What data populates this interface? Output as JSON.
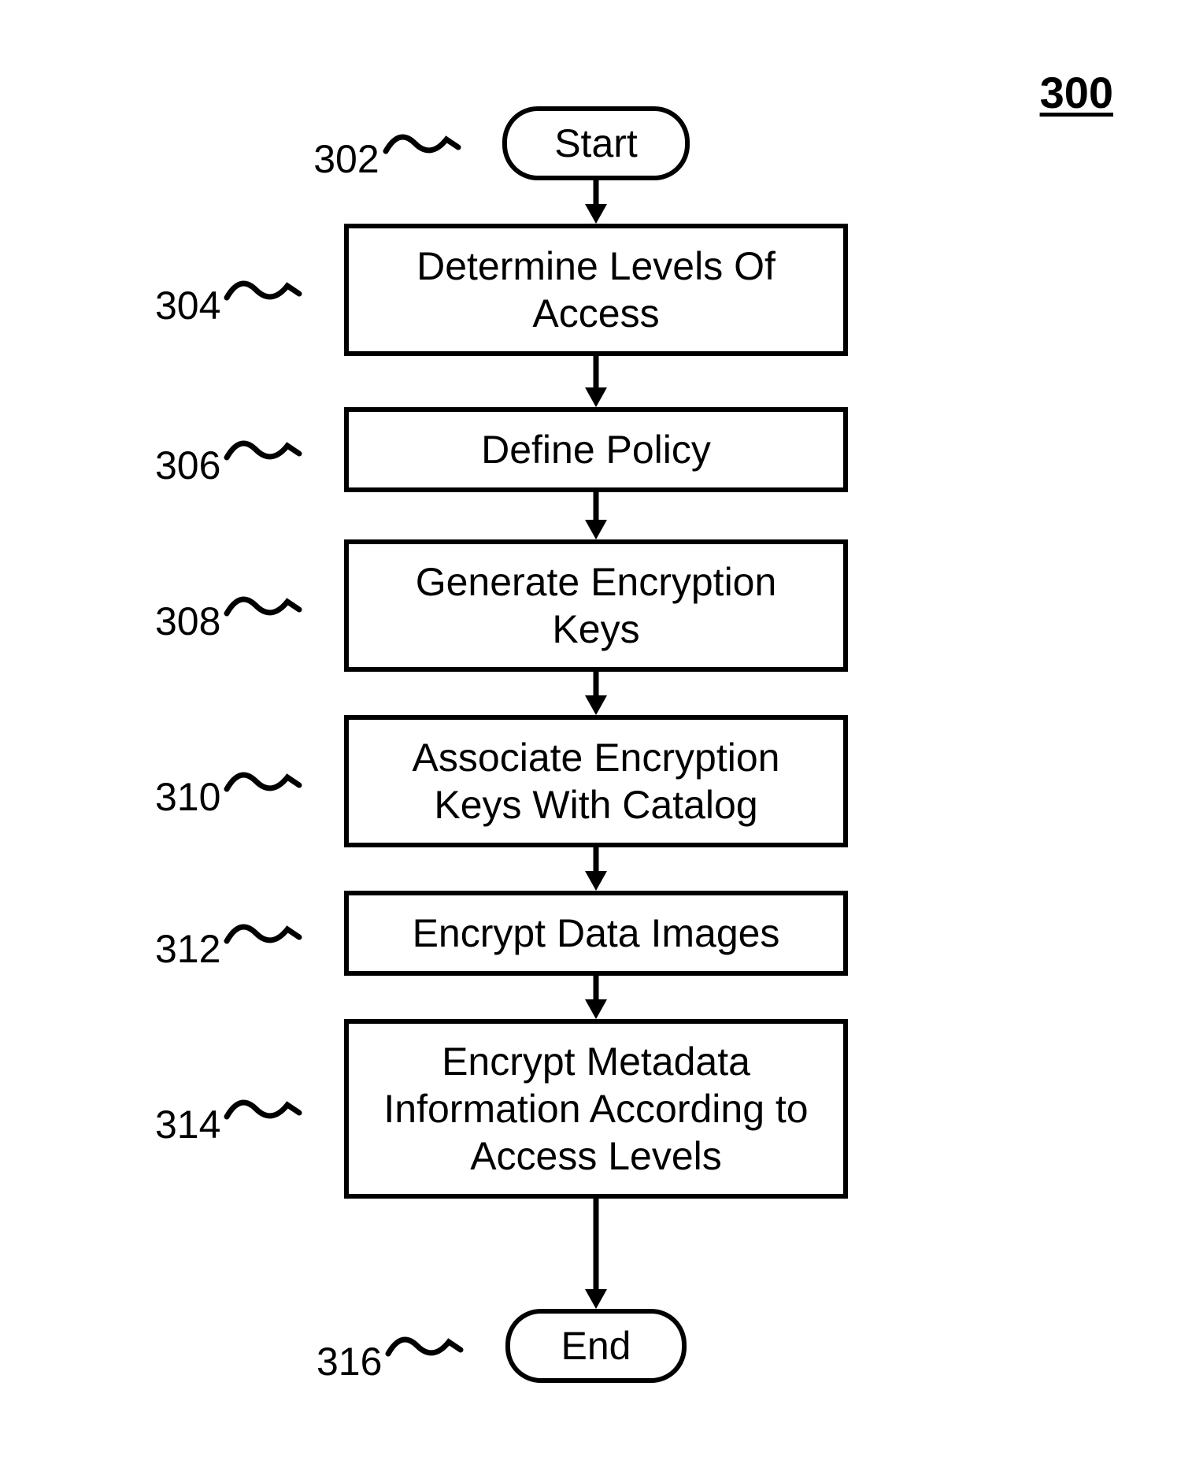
{
  "figure_number": "300",
  "flowchart": {
    "steps": [
      {
        "ref": "302",
        "type": "terminal",
        "label": "Start"
      },
      {
        "ref": "304",
        "type": "process",
        "label": "Determine Levels Of Access"
      },
      {
        "ref": "306",
        "type": "process",
        "label": "Define Policy"
      },
      {
        "ref": "308",
        "type": "process",
        "label": "Generate Encryption Keys"
      },
      {
        "ref": "310",
        "type": "process",
        "label": "Associate Encryption Keys With Catalog"
      },
      {
        "ref": "312",
        "type": "process",
        "label": "Encrypt Data Images"
      },
      {
        "ref": "314",
        "type": "process",
        "label": "Encrypt Metadata Information According to Access Levels"
      },
      {
        "ref": "316",
        "type": "terminal",
        "label": "End"
      }
    ]
  }
}
